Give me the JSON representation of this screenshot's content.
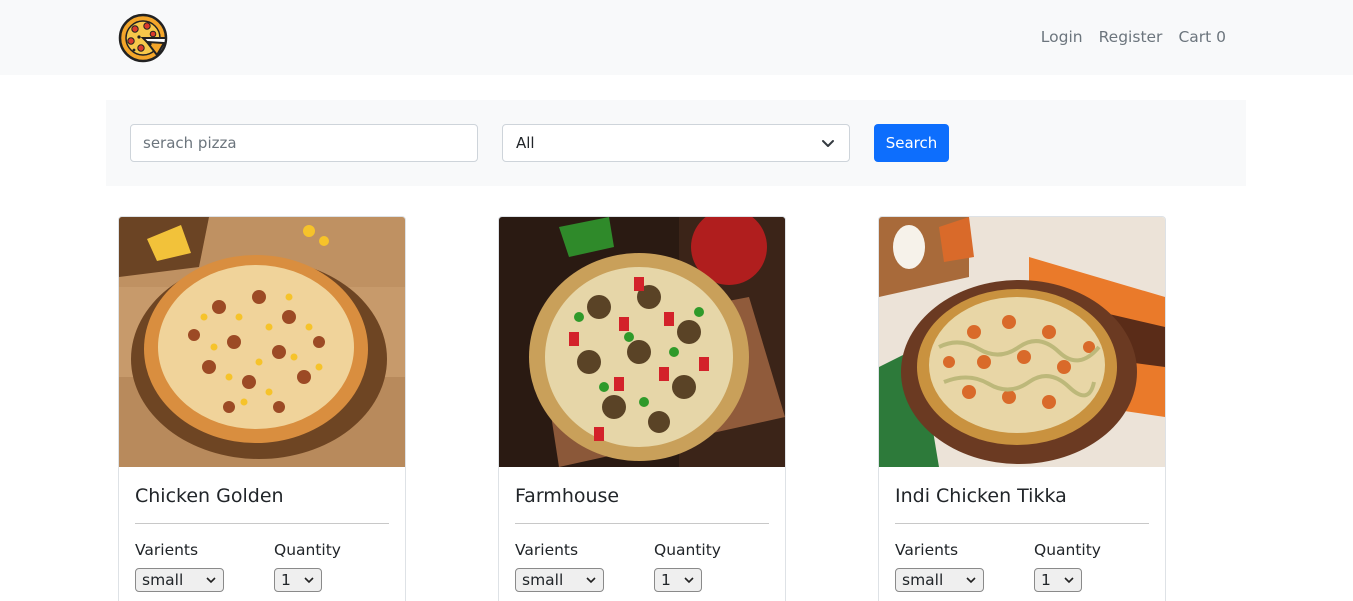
{
  "nav": {
    "login": "Login",
    "register": "Register",
    "cart": "Cart 0"
  },
  "filter": {
    "search_placeholder": "serach pizza",
    "category_selected": "All",
    "search_label": "Search"
  },
  "cards": [
    {
      "title": "Chicken Golden",
      "varients_label": "Varients",
      "quantity_label": "Quantity",
      "varient": "small",
      "quantity": "1"
    },
    {
      "title": "Farmhouse",
      "varients_label": "Varients",
      "quantity_label": "Quantity",
      "varient": "small",
      "quantity": "1"
    },
    {
      "title": "Indi Chicken Tikka",
      "varients_label": "Varients",
      "quantity_label": "Quantity",
      "varient": "small",
      "quantity": "1"
    }
  ],
  "colors": {
    "primary": "#0d6efd",
    "navbar_bg": "#f8f9fa",
    "nav_text": "#6c757d"
  }
}
